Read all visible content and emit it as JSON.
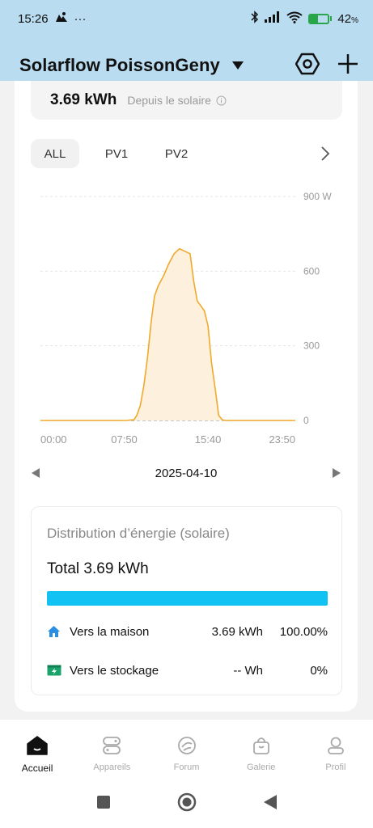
{
  "status_bar": {
    "time": "15:26",
    "dots": "···",
    "battery_text": "42",
    "battery_unit": "%",
    "battery_level": 0.42
  },
  "header": {
    "title": "Solarflow PoissonGeny"
  },
  "summary": {
    "value": "3.69 kWh",
    "label": "Depuis le solaire"
  },
  "tabs": [
    {
      "label": "ALL",
      "active": true
    },
    {
      "label": "PV1",
      "active": false
    },
    {
      "label": "PV2",
      "active": false
    }
  ],
  "chart_data": {
    "type": "area",
    "y_ticks": [
      "900 W",
      "600",
      "300",
      "0"
    ],
    "x_ticks": [
      "00:00",
      "07:50",
      "15:40",
      "23:50"
    ],
    "ylim": [
      0,
      900
    ],
    "series": [
      {
        "unit": "W",
        "color": "#f0a92a",
        "x": [
          "00:00",
          "07:00",
          "08:00",
          "08:45",
          "09:00",
          "09:20",
          "09:40",
          "10:00",
          "10:20",
          "10:40",
          "11:00",
          "11:30",
          "12:00",
          "12:30",
          "13:00",
          "13:30",
          "14:00",
          "14:20",
          "14:40",
          "15:00",
          "15:20",
          "15:40",
          "16:00",
          "16:20",
          "16:40",
          "17:00",
          "17:20",
          "17:40",
          "18:00",
          "19:00",
          "23:50"
        ],
        "y": [
          0,
          0,
          0,
          3,
          20,
          60,
          140,
          250,
          390,
          500,
          540,
          580,
          630,
          670,
          690,
          680,
          670,
          560,
          480,
          460,
          440,
          380,
          230,
          130,
          20,
          3,
          0,
          0,
          0,
          0,
          0
        ]
      }
    ],
    "grid": true
  },
  "date_nav": {
    "date": "2025-04-10"
  },
  "distribution": {
    "title": "Distribution d’énergie (solaire)",
    "total": "Total 3.69 kWh",
    "bar_fill": 1.0,
    "rows": [
      {
        "label": "Vers la maison",
        "value": "3.69 kWh",
        "percent": "100.00%",
        "icon": "house-icon"
      },
      {
        "label": "Vers le stockage",
        "value": "-- Wh",
        "percent": "0%",
        "icon": "battery-storage-icon"
      }
    ]
  },
  "bottom_nav": [
    {
      "label": "Accueil",
      "active": true,
      "icon": "home-icon"
    },
    {
      "label": "Appareils",
      "active": false,
      "icon": "devices-icon"
    },
    {
      "label": "Forum",
      "active": false,
      "icon": "forum-icon"
    },
    {
      "label": "Galerie",
      "active": false,
      "icon": "shop-bag-icon"
    },
    {
      "label": "Profil",
      "active": false,
      "icon": "user-icon"
    }
  ],
  "colors": {
    "header_bg": "#b9dcf0",
    "accent_bar": "#12c2f2",
    "chart_line": "#f0a92a",
    "chart_fill": "#fdf0dc",
    "house_icon": "#2a8fe0",
    "storage_icon": "#1aa36a"
  }
}
